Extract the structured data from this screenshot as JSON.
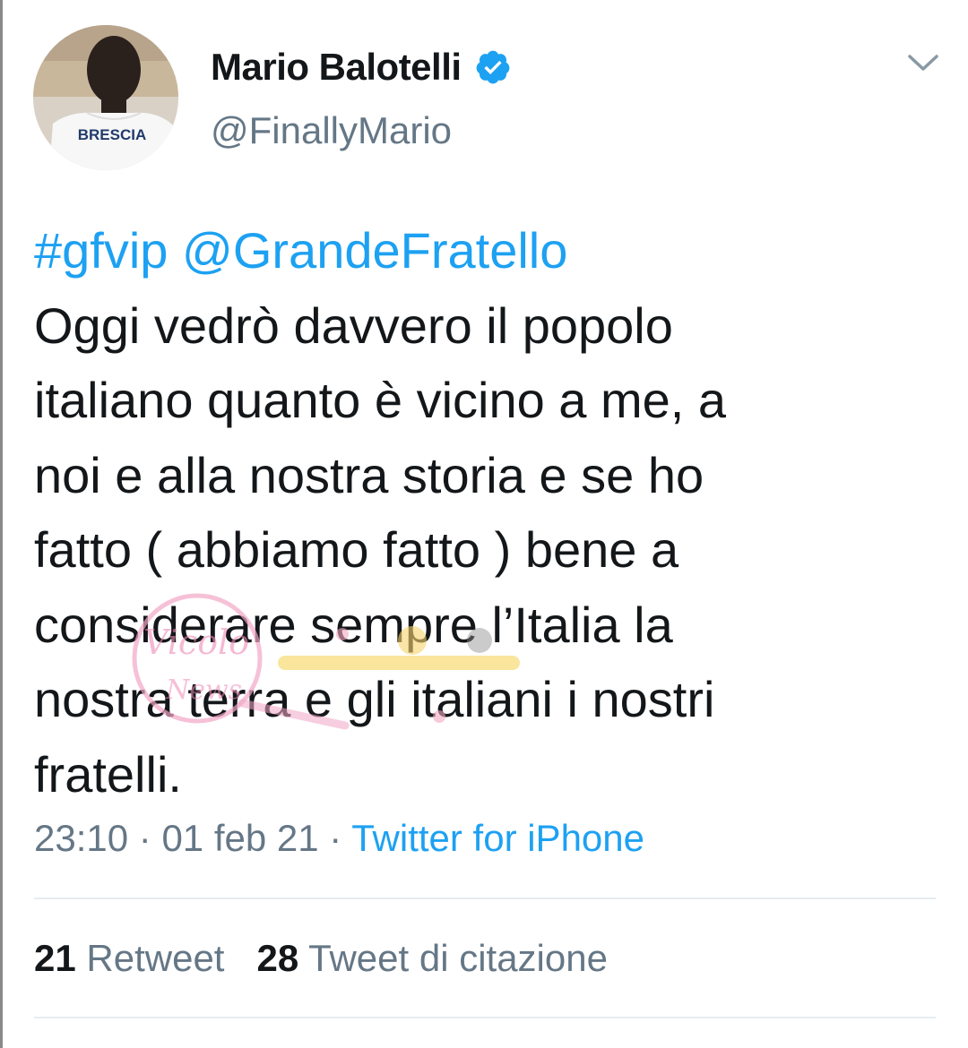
{
  "user": {
    "display_name": "Mario Balotelli",
    "handle": "@FinallyMario",
    "verified": true,
    "avatar_jersey_text": "BRESCIA"
  },
  "tweet": {
    "hashtag": "#gfvip",
    "mention": "@GrandeFratello",
    "lines": [
      "Oggi vedrò davvero il popolo",
      "italiano quanto è vicino a me, a",
      "noi e alla nostra storia e se ho",
      "fatto ( abbiamo fatto ) bene a",
      "considerare sempre l’Italia la",
      "nostra terra e gli italiani i nostri",
      "fratelli."
    ]
  },
  "meta": {
    "time": "23:10",
    "date": "01 feb 21",
    "separator": " · ",
    "source": "Twitter for iPhone"
  },
  "stats": {
    "retweets_count": "21",
    "retweets_label": "Retweet",
    "quotes_count": "28",
    "quotes_label": "Tweet di citazione"
  },
  "icons": {
    "verified": "verified-badge-icon",
    "menu": "chevron-down-icon"
  },
  "colors": {
    "link_blue": "#1da1f2",
    "text_primary": "#14171a",
    "text_secondary": "#657786",
    "divider": "#e6ecf0"
  }
}
